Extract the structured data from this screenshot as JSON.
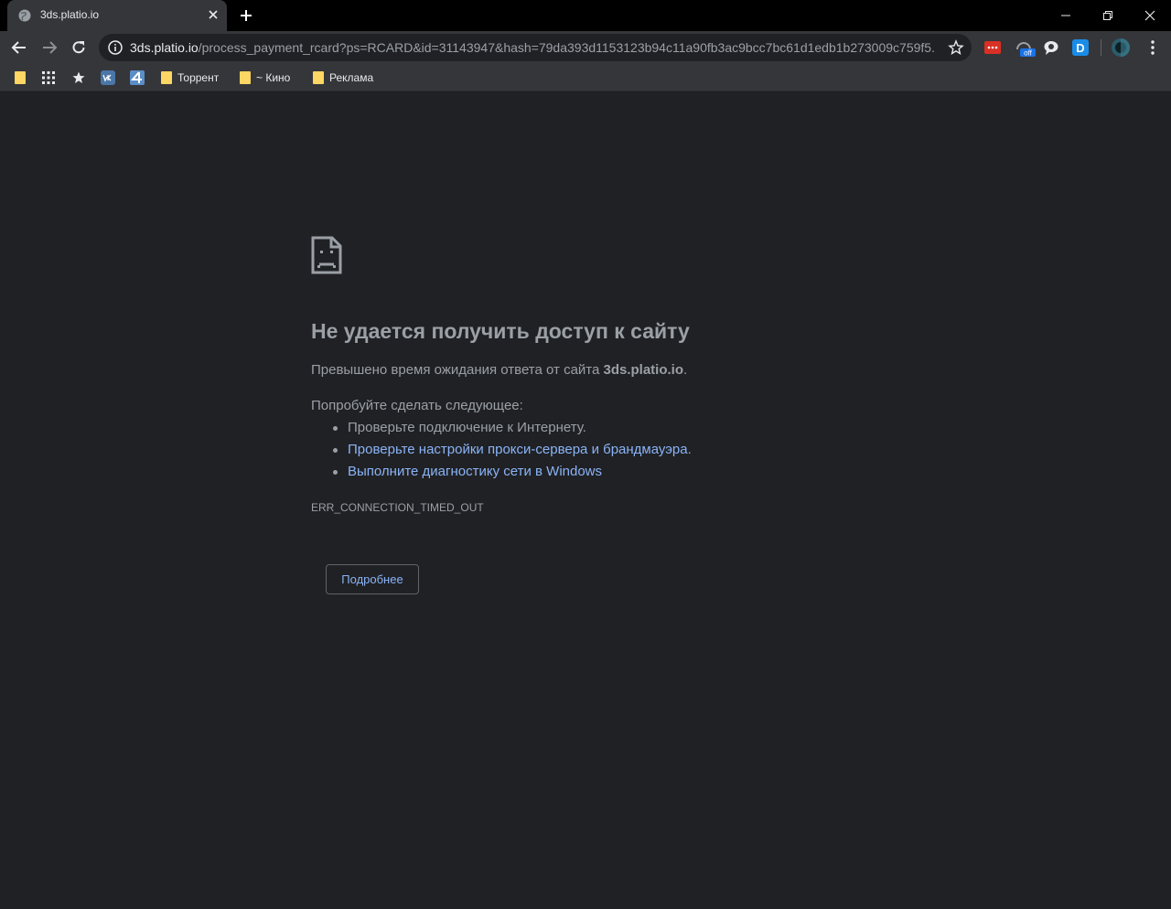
{
  "tab": {
    "title": "3ds.platio.io"
  },
  "omnibox": {
    "host": "3ds.platio.io",
    "path": "/process_payment_rcard?ps=RCARD&id=31143947&hash=79da393d1153123b94c11a90fb3ac9bcc7bc61d1edb1b273009c759f5..."
  },
  "bookmarks": [
    {
      "label": ""
    },
    {
      "label": "Торрент"
    },
    {
      "label": "~ Кино"
    },
    {
      "label": "Реклама"
    }
  ],
  "extensions": {
    "off_badge": "off",
    "d_letter": "D"
  },
  "error": {
    "title": "Не удается получить доступ к сайту",
    "desc_prefix": "Превышено время ожидания ответа от сайта ",
    "desc_host": "3ds.platio.io",
    "desc_suffix": ".",
    "try_heading": "Попробуйте сделать следующее:",
    "suggestions": [
      {
        "text": "Проверьте подключение к Интернету.",
        "link": false
      },
      {
        "text": "Проверьте настройки прокси-сервера и брандмауэра",
        "link": true,
        "suffix": "."
      },
      {
        "text": "Выполните диагностику сети в Windows",
        "link": true,
        "suffix": ""
      }
    ],
    "code": "ERR_CONNECTION_TIMED_OUT",
    "details_button": "Подробнее"
  },
  "colors": {
    "background": "#202124",
    "toolbar": "#35363a",
    "link": "#8ab4f8",
    "text": "#9aa0a6"
  }
}
